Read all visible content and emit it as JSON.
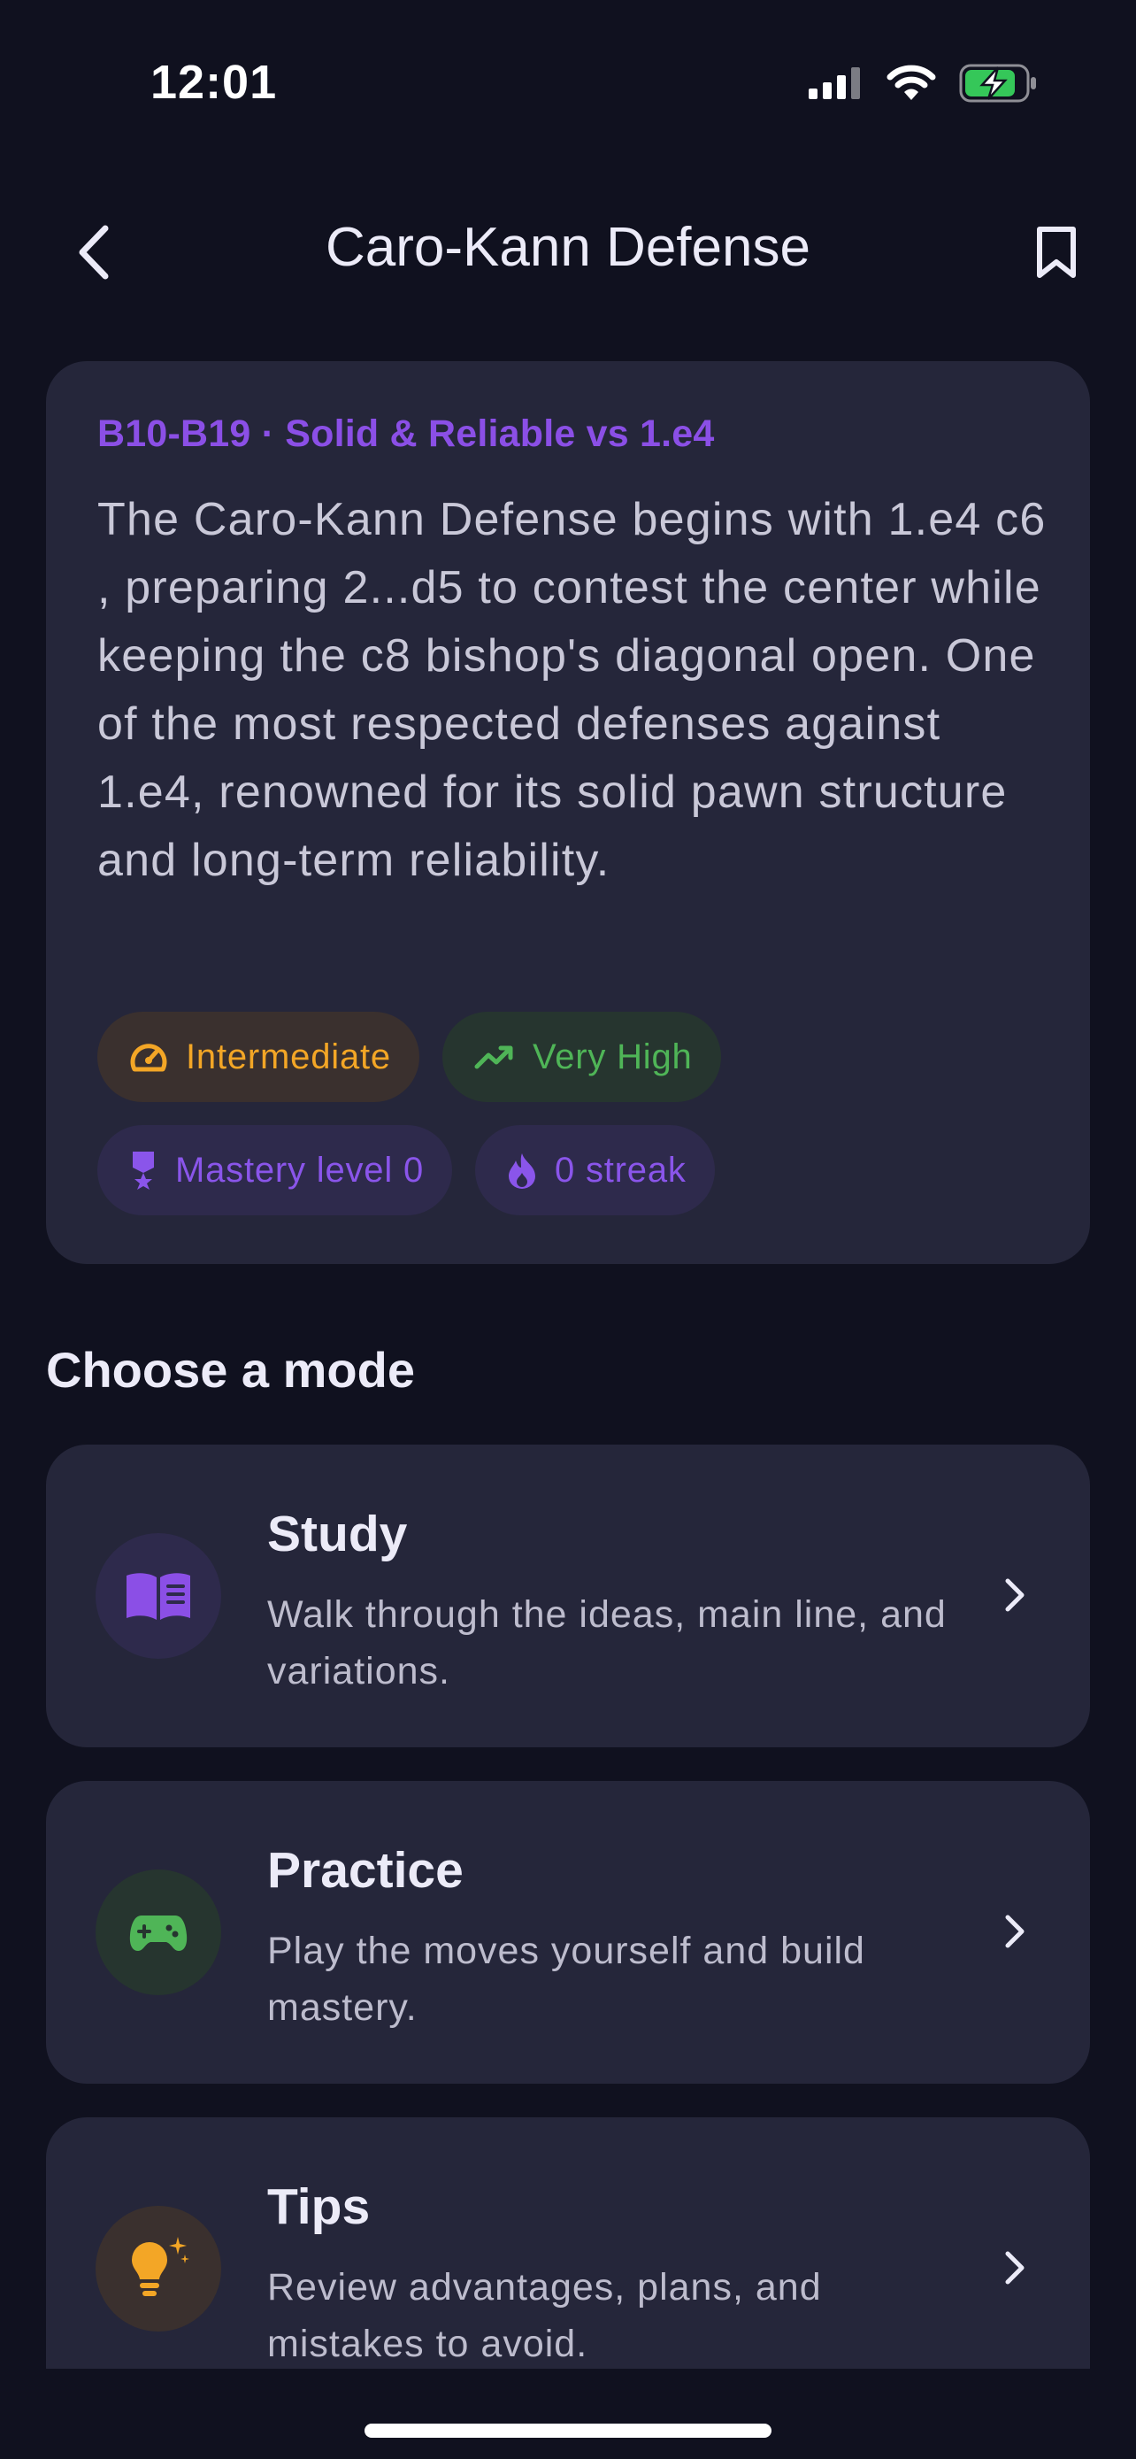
{
  "status_bar": {
    "time": "12:01"
  },
  "nav": {
    "title": "Caro-Kann Defense"
  },
  "info": {
    "eco": "B10-B19 · Solid & Reliable vs 1.e4",
    "description": "The Caro-Kann Defense begins with 1.e4 c6 , preparing 2...d5 to contest the center while keeping the c8 bishop's diagonal open. One of the most respected defenses against 1.e4, renowned for its solid pawn structure and long-term reliability.",
    "chips": {
      "difficulty": {
        "label": "Intermediate",
        "icon": "gauge-icon"
      },
      "popularity": {
        "label": "Very High",
        "icon": "trending-up-icon"
      },
      "mastery": {
        "label": "Mastery level 0",
        "icon": "medal-icon"
      },
      "streak": {
        "label": "0 streak",
        "icon": "flame-icon"
      }
    }
  },
  "section": {
    "title": "Choose a mode"
  },
  "modes": [
    {
      "title": "Study",
      "description": "Walk through the ideas, main line, and variations.",
      "icon": "book-icon",
      "accent": "#8b4fe6"
    },
    {
      "title": "Practice",
      "description": "Play the moves yourself and build mastery.",
      "icon": "gamepad-icon",
      "accent": "#4fb557"
    },
    {
      "title": "Tips",
      "description": "Review advantages, plans, and mistakes to avoid.",
      "icon": "lightbulb-icon",
      "accent": "#f3a626"
    }
  ],
  "colors": {
    "background": "#10111f",
    "card": "#25263a",
    "accent_purple": "#8b4fe6",
    "accent_green": "#4fb557",
    "accent_orange": "#f3a626"
  }
}
